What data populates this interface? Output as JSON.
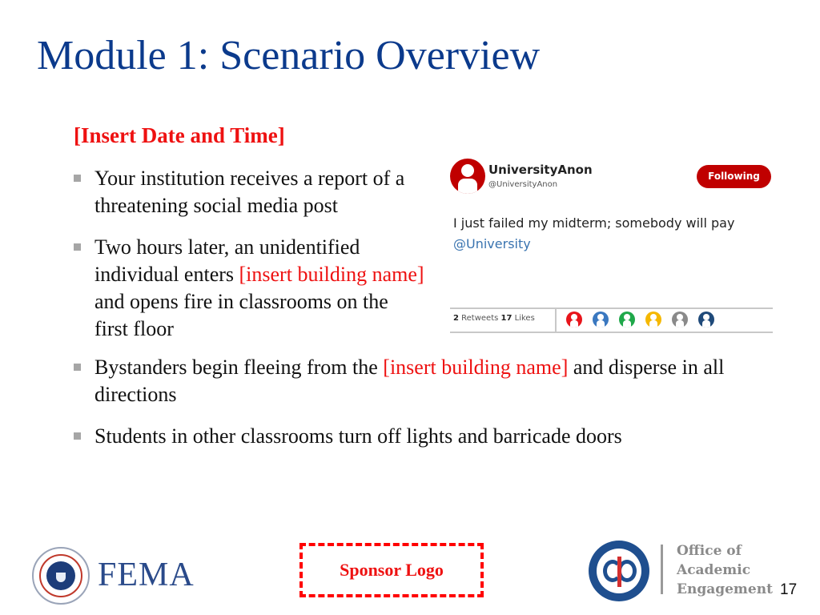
{
  "slide": {
    "title": "Module 1: Scenario Overview",
    "date_placeholder": "[Insert Date and Time]",
    "bullets": [
      {
        "parts": [
          "Your institution receives a report of a threatening social media post"
        ]
      },
      {
        "parts": [
          "Two hours later, an unidentified individual enters ",
          "[insert building name]",
          " and opens fire in classrooms on the first floor"
        ]
      },
      {
        "parts": [
          "Bystanders begin fleeing from the ",
          "[insert building name]",
          " and disperse in all directions"
        ]
      },
      {
        "parts": [
          "Students in other classrooms turn off lights and barricade doors"
        ]
      }
    ],
    "page_number": "17"
  },
  "tweet": {
    "username": "UniversityAnon",
    "handle": "@UniversityAnon",
    "follow_button": "Following",
    "text": "I just failed my midterm; somebody will pay",
    "mention": "@University",
    "retweets_count": "2",
    "retweets_label": "Retweets",
    "likes_count": "17",
    "likes_label": "Likes",
    "liker_avatar_colors": [
      "#e8141b",
      "#3a78c0",
      "#1fa84a",
      "#f5b800",
      "#8a8a8a",
      "#1f4a7a"
    ],
    "accent_color": "#c00000"
  },
  "footer": {
    "fema_label": "FEMA",
    "sponsor_label": "Sponsor Logo",
    "office_lines": [
      "Office of",
      "Academic",
      "Engagement"
    ]
  }
}
